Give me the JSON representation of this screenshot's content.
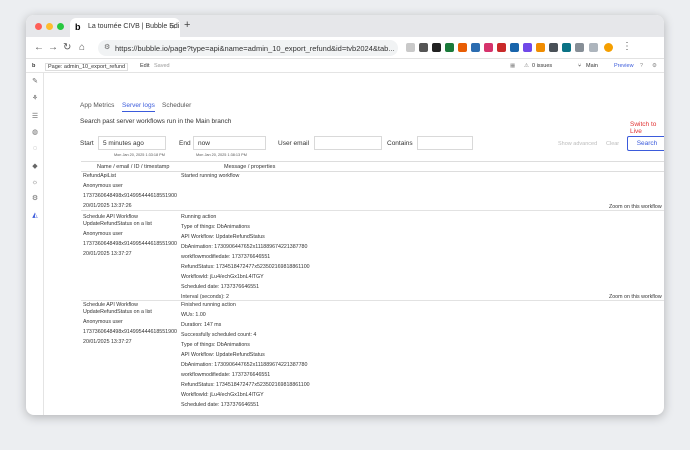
{
  "browser": {
    "tab_title": "La tournée CIVB | Bubble Edi",
    "tab_favicon": "b",
    "url": "https://bubble.io/page?type=api&name=admin_10_export_refund&id=tvb2024&tab..."
  },
  "editor": {
    "page_selector": "Page: admin_10_export_refund",
    "edit": "Edit",
    "saved": "Saved",
    "issues": "0 issues",
    "branch": "Main",
    "preview": "Preview"
  },
  "logs": {
    "tabs": [
      "App Metrics",
      "Server logs",
      "Scheduler"
    ],
    "description": "Search past server workflows run in the Main branch",
    "switch_live": "Switch to Live",
    "start_label": "Start",
    "start_value": "5 minutes ago",
    "start_sub": "Mon Jan 20, 2025 1:33:18 PM",
    "end_label": "End",
    "end_value": "now",
    "end_sub": "Mon Jan 20, 2025 1:38:13 PM",
    "user_email_label": "User email",
    "contains_label": "Contains",
    "show_advanced": "Show advanced",
    "clear": "Clear",
    "search": "Search",
    "col1": "Name / email / ID / timestamp",
    "col2": "Message / properties",
    "zoom_label": "Zoom on this workflow",
    "entries": [
      {
        "left": [
          "RefundApiList",
          "Anonymous user",
          "1737360648498x914995444618551900",
          "20/01/2025 13:37:26"
        ],
        "right": [
          "Started running workflow"
        ]
      },
      {
        "left": [
          "Schedule API Workflow",
          "UpdateRefundStatus on a list",
          "Anonymous user",
          "1737360648498x914995444618551900",
          "20/01/2025 13:37:27"
        ],
        "right": [
          "Running action",
          "Type of things: DbAnimations",
          "API Workflow: UpdateRefundStatus",
          "DbAnimation: 1730906447652x111889674221387780",
          "workflowmodifiedate: 1737376646551",
          "RefundStatus: 1734518472477x523502169818861100",
          "WorkflowId: jLu4/echGx1bnL4lTGY",
          "Scheduled date: 1737376646551",
          "Interval (seconds): 2"
        ]
      },
      {
        "left": [
          "Schedule API Workflow",
          "UpdateRefundStatus on a list",
          "Anonymous user",
          "1737360648498x914995444618551900",
          "20/01/2025 13:37:27"
        ],
        "right": [
          "Finished running action",
          "WUs: 1.00",
          "Duration: 147 ms",
          "Successfully scheduled count: 4",
          "Type of things: DbAnimations",
          "API Workflow: UpdateRefundStatus",
          "DbAnimation: 1730906447652x111889674221387780",
          "workflowmodifiedate: 1737376646551",
          "RefundStatus: 1734518472477x523502169818861100",
          "WorkflowId: jLu4/echGx1bnL4lTGY",
          "Scheduled date: 1737376646551"
        ]
      }
    ]
  }
}
